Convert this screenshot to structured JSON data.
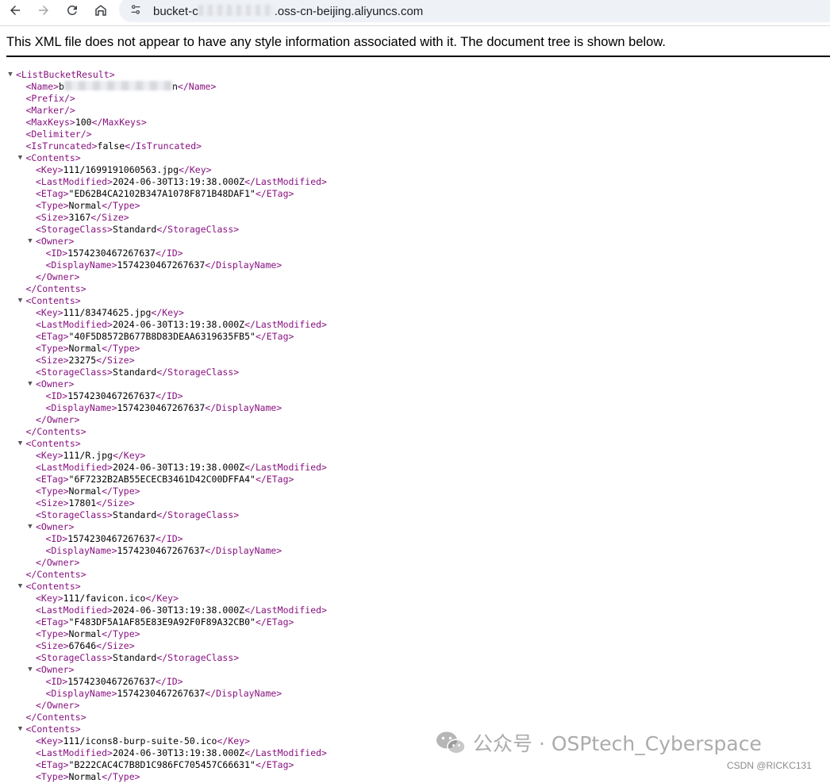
{
  "browser": {
    "address_prefix": "bucket-c",
    "address_suffix": ".oss-cn-beijing.aliyuncs.com"
  },
  "xml_note": "This XML file does not appear to have any style information associated with it. The document tree is shown below.",
  "root_tag": "ListBucketResult",
  "bucket_name_visible": "b",
  "bucket_name_tail": "n",
  "header_fields": [
    {
      "tag": "Prefix",
      "value": ""
    },
    {
      "tag": "Marker",
      "value": ""
    },
    {
      "tag": "MaxKeys",
      "value": "100"
    },
    {
      "tag": "Delimiter",
      "value": ""
    },
    {
      "tag": "IsTruncated",
      "value": "false"
    }
  ],
  "contents": [
    {
      "Key": "111/1699191060563.jpg",
      "LastModified": "2024-06-30T13:19:38.000Z",
      "ETag": "\"ED62B4CA2102B347A1078F871B48DAF1\"",
      "Type": "Normal",
      "Size": "3167",
      "StorageClass": "Standard",
      "Owner": {
        "ID": "1574230467267637",
        "DisplayName": "1574230467267637"
      }
    },
    {
      "Key": "111/83474625.jpg",
      "LastModified": "2024-06-30T13:19:38.000Z",
      "ETag": "\"40F5D8572B677B8D83DEAA6319635FB5\"",
      "Type": "Normal",
      "Size": "23275",
      "StorageClass": "Standard",
      "Owner": {
        "ID": "1574230467267637",
        "DisplayName": "1574230467267637"
      }
    },
    {
      "Key": "111/R.jpg",
      "LastModified": "2024-06-30T13:19:38.000Z",
      "ETag": "\"6F7232B2AB55ECECB3461D42C00DFFA4\"",
      "Type": "Normal",
      "Size": "17801",
      "StorageClass": "Standard",
      "Owner": {
        "ID": "1574230467267637",
        "DisplayName": "1574230467267637"
      }
    },
    {
      "Key": "111/favicon.ico",
      "LastModified": "2024-06-30T13:19:38.000Z",
      "ETag": "\"F483DF5A1AF85E83E9A92F0F89A32CB0\"",
      "Type": "Normal",
      "Size": "67646",
      "StorageClass": "Standard",
      "Owner": {
        "ID": "1574230467267637",
        "DisplayName": "1574230467267637"
      }
    },
    {
      "Key": "111/icons8-burp-suite-50.ico",
      "LastModified": "2024-06-30T13:19:38.000Z",
      "ETag": "\"B222CAC4C7B8D1C986FC705457C66631\"",
      "Type": "Normal"
    }
  ],
  "watermark": "公众号 · OSPtech_Cyberspace",
  "credit": "CSDN @RICKC131",
  "icons": {
    "back": "arrow-left-icon",
    "forward": "arrow-right-icon",
    "reload": "reload-icon",
    "home": "home-icon",
    "site_info": "tune-icon",
    "watermark": "wechat-icon"
  }
}
